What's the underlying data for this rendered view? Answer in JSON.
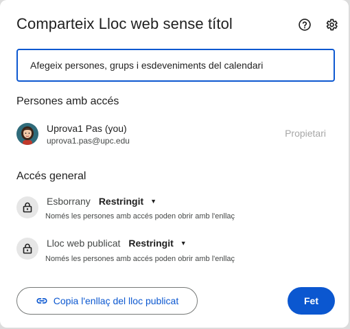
{
  "dialog": {
    "title": "Comparteix Lloc web sense títol"
  },
  "share_input": {
    "placeholder": "Afegeix persones, grups i esdeveniments del calendari"
  },
  "people": {
    "heading": "Persones amb accés",
    "owner": {
      "name": "Uprova1 Pas (you)",
      "email": "uprova1.pas@upc.edu",
      "role": "Propietari"
    }
  },
  "general_access": {
    "heading": "Accés general",
    "items": [
      {
        "label": "Esborrany",
        "value": "Restringit",
        "description": "Només les persones amb accés poden obrir amb l'enllaç"
      },
      {
        "label": "Lloc web publicat",
        "value": "Restringit",
        "description": "Només les persones amb accés poden obrir amb l'enllaç"
      }
    ]
  },
  "actions": {
    "copy_link": "Copia l'enllaç del lloc publicat",
    "done": "Fet"
  },
  "colors": {
    "accent": "#0b57d0",
    "text": "#1f1f1f",
    "muted": "#444746"
  }
}
